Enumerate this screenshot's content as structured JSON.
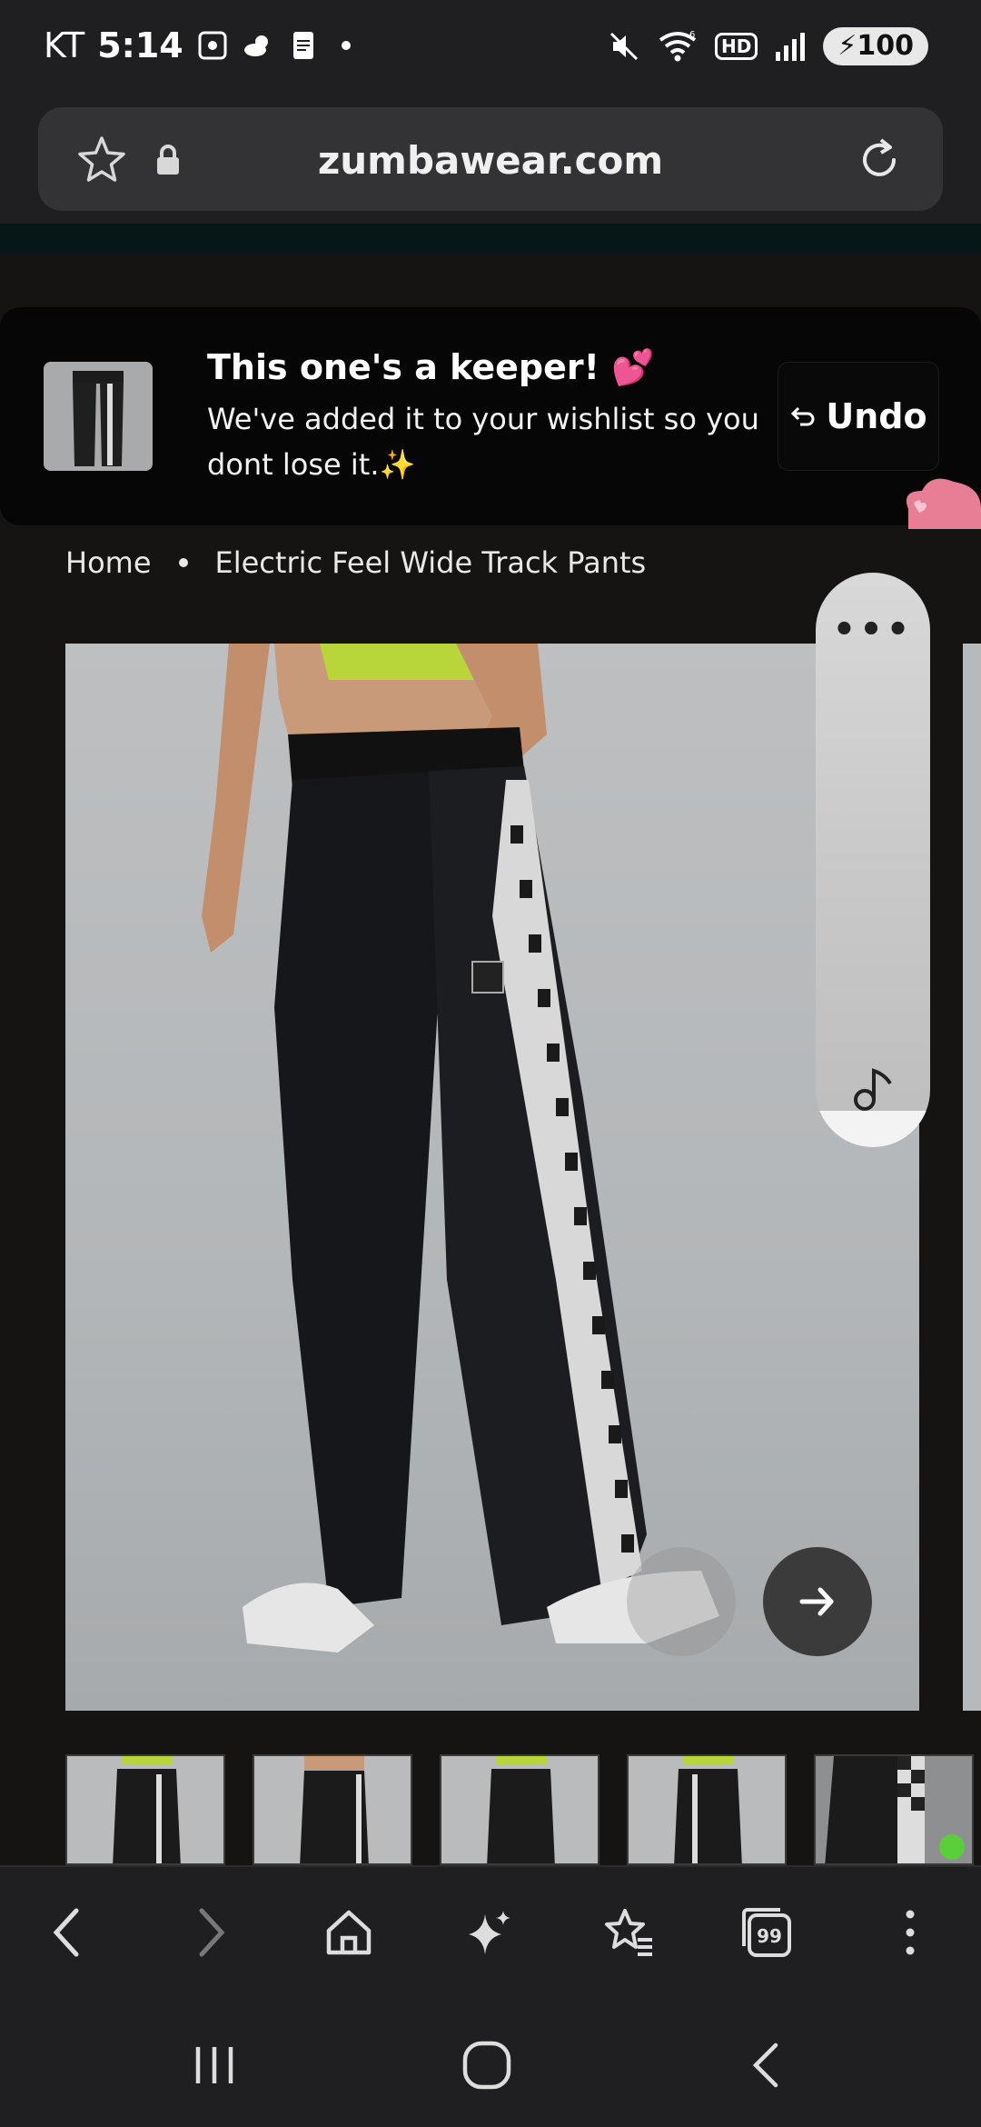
{
  "status_bar": {
    "carrier": "KT",
    "time": "5:14",
    "battery": "100",
    "network_badge": "HD",
    "wifi_badge": "6"
  },
  "browser": {
    "url": "zumbawear.com",
    "icons": [
      "star-icon",
      "lock-icon",
      "reload-icon"
    ]
  },
  "toast": {
    "title": "This one's a keeper! 💕",
    "message": "We've added it to your wishlist so you dont lose it.✨",
    "undo_label": "Undo"
  },
  "breadcrumb": {
    "items": [
      "Home",
      "Electric Feel Wide Track Pants"
    ]
  },
  "floating_panel": {
    "menu_dots": "•••"
  },
  "bottom_nav": {
    "items": [
      "back-icon",
      "forward-icon",
      "home-icon",
      "sparkle-icon",
      "bookmarks-icon",
      "tabs-icon",
      "more-icon"
    ],
    "tabs_count": "99"
  },
  "system_nav": {
    "items": [
      "recents-icon",
      "home-circle-icon",
      "system-back-icon"
    ]
  },
  "colors": {
    "background": "#141414",
    "toast_bg": "#060606",
    "bar_bg": "#1f1f21",
    "urlbar_bg": "#333336",
    "pink_accent": "#e87e95"
  }
}
